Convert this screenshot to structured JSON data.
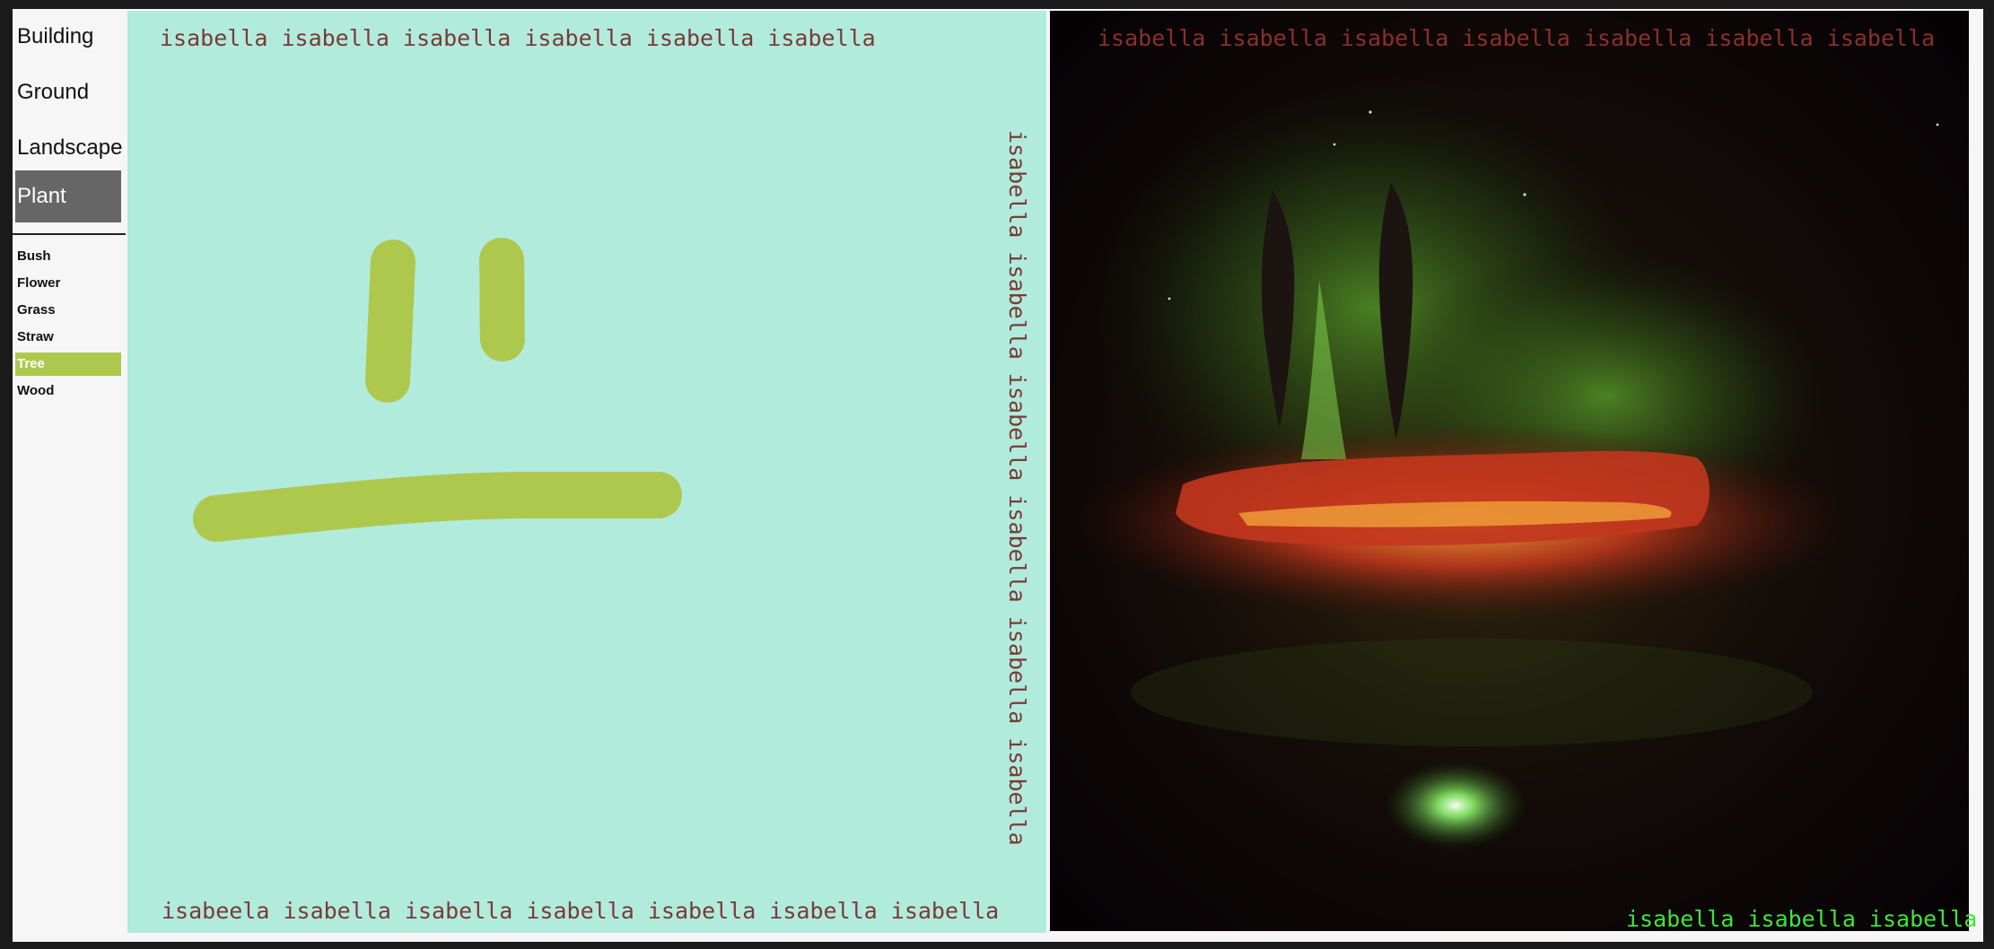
{
  "sidebar": {
    "categories": [
      {
        "label": "Building",
        "active": false
      },
      {
        "label": "Ground",
        "active": false
      },
      {
        "label": "Landscape",
        "active": false
      },
      {
        "label": "Plant",
        "active": true
      }
    ],
    "subcategories": [
      {
        "label": "Bush",
        "active": false
      },
      {
        "label": "Flower",
        "active": false
      },
      {
        "label": "Grass",
        "active": false
      },
      {
        "label": "Straw",
        "active": false
      },
      {
        "label": "Tree",
        "active": true
      },
      {
        "label": "Wood",
        "active": false
      }
    ]
  },
  "canvas": {
    "background_color": "#b1ebdc",
    "brush_color": "#aec84e",
    "top_text": "isabella isabella isabella isabella isabella isabella",
    "right_text": "isabella isabella isabella isabella isabella isabella",
    "bottom_text": "isabeela isabella isabella isabella isabella isabella isabella",
    "label_color": "#7a3a36"
  },
  "output": {
    "top_text": "isabella isabella isabella isabella isabella isabella isabella",
    "top_text_color": "#8c2f2a",
    "bottom_text": "isabella isabella isabella",
    "bottom_text_color": "#3ee63a"
  }
}
